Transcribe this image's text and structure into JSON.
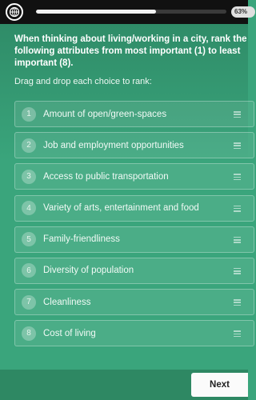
{
  "header": {
    "logo_icon": "globe-grid-logo-icon",
    "progress_value": 0.63,
    "progress_label": "63%"
  },
  "question": {
    "text": "When thinking about living/working in a city, rank the following attributes from most important (1) to least important (8).",
    "instruction": "Drag and drop each choice to rank:"
  },
  "choices": [
    {
      "number": "1",
      "label": "Amount of open/green-spaces"
    },
    {
      "number": "2",
      "label": "Job and employment opportunities"
    },
    {
      "number": "3",
      "label": "Access to public transportation"
    },
    {
      "number": "4",
      "label": "Variety of arts, entertainment and food"
    },
    {
      "number": "5",
      "label": "Family-friendliness"
    },
    {
      "number": "6",
      "label": "Diversity of population"
    },
    {
      "number": "7",
      "label": "Cleanliness"
    },
    {
      "number": "8",
      "label": "Cost of living"
    }
  ],
  "footer": {
    "next_label": "Next"
  },
  "colors": {
    "background": "#3aa57c",
    "topbar": "#111111",
    "button": "#fbfbfb"
  }
}
